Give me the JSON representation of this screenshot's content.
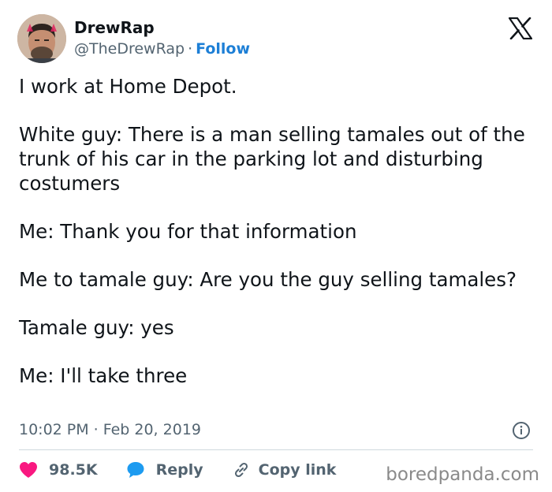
{
  "author": {
    "display_name": "DrewRap",
    "handle": "@TheDrewRap",
    "separator": "·",
    "follow_label": "Follow"
  },
  "brand_icon": "x-logo-icon",
  "tweet": {
    "paragraphs": [
      "I work at Home Depot.",
      "White guy: There is a man selling tamales out of the trunk of his car in the parking lot and disturbing costumers",
      "Me: Thank you for that information",
      "Me to tamale guy: Are you the guy selling tamales?",
      "Tamale guy: yes",
      "Me: I'll take three"
    ]
  },
  "meta": {
    "time": "10:02 PM",
    "separator": "·",
    "date": "Feb 20, 2019"
  },
  "actions": {
    "like_count": "98.5K",
    "reply_label": "Reply",
    "copy_link_label": "Copy link"
  },
  "watermark": "boredpanda.com",
  "colors": {
    "like": "#f91880",
    "reply": "#1d9bf0",
    "link": "#1d7fd6",
    "secondary_text": "#536471",
    "divider": "#cfd9de"
  }
}
